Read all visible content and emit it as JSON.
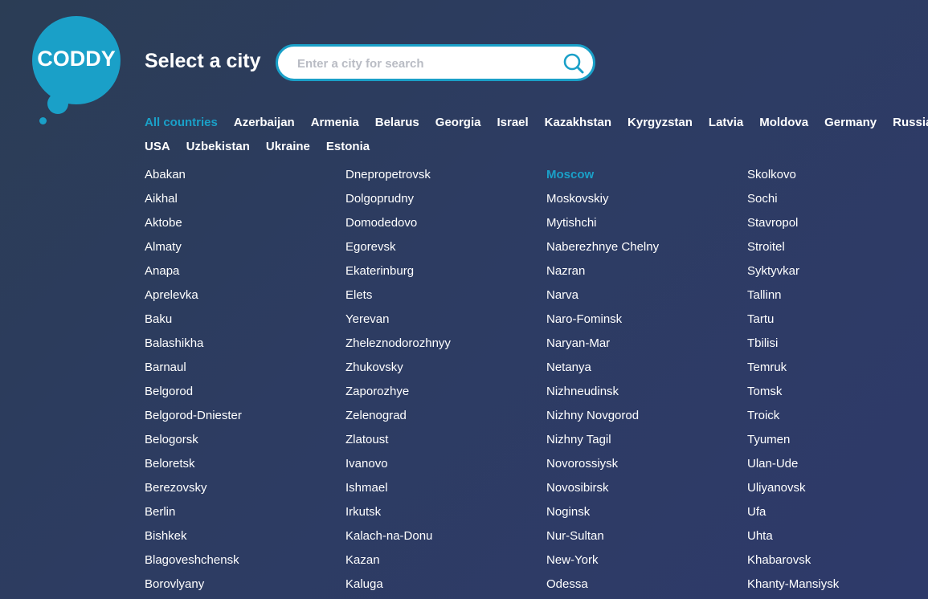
{
  "logo": {
    "text": "CODDY"
  },
  "title": "Select a city",
  "search": {
    "placeholder": "Enter a city for search",
    "value": ""
  },
  "countries_row1": [
    {
      "label": "All countries",
      "active": true
    },
    {
      "label": "Azerbaijan"
    },
    {
      "label": "Armenia"
    },
    {
      "label": "Belarus"
    },
    {
      "label": "Georgia"
    },
    {
      "label": "Israel"
    },
    {
      "label": "Kazakhstan"
    },
    {
      "label": "Kyrgyzstan"
    },
    {
      "label": "Latvia"
    },
    {
      "label": "Moldova"
    },
    {
      "label": "Germany"
    },
    {
      "label": "Russia"
    }
  ],
  "countries_row2": [
    {
      "label": "USA"
    },
    {
      "label": "Uzbekistan"
    },
    {
      "label": "Ukraine"
    },
    {
      "label": "Estonia"
    }
  ],
  "city_columns": [
    [
      "Abakan",
      "Aikhal",
      "Aktobe",
      "Almaty",
      "Anapa",
      "Aprelevka",
      "Baku",
      "Balashikha",
      "Barnaul",
      "Belgorod",
      "Belgorod-Dniester",
      "Belogorsk",
      "Beloretsk",
      "Berezovsky",
      "Berlin",
      "Bishkek",
      "Blagoveshchensk",
      "Borovlyany"
    ],
    [
      "Dnepropetrovsk",
      "Dolgoprudny",
      "Domodedovo",
      "Egorevsk",
      "Ekaterinburg",
      "Elets",
      "Yerevan",
      "Zheleznodorozhnyy",
      "Zhukovsky",
      "Zaporozhye",
      "Zelenograd",
      "Zlatoust",
      "Ivanovo",
      "Ishmael",
      "Irkutsk",
      "Kalach-na-Donu",
      "Kazan",
      "Kaluga"
    ],
    [
      "Moscow",
      "Moskovskiy",
      "Mytishchi",
      "Naberezhnye Chelny",
      "Nazran",
      "Narva",
      "Naro-Fominsk",
      "Naryan-Mar",
      "Netanya",
      "Nizhneudinsk",
      "Nizhny Novgorod",
      "Nizhny Tagil",
      "Novorossiysk",
      "Novosibirsk",
      "Noginsk",
      "Nur-Sultan",
      "New-York",
      "Odessa"
    ],
    [
      "Skolkovo",
      "Sochi",
      "Stavropol",
      "Stroitel",
      "Syktyvkar",
      "Tallinn",
      "Tartu",
      "Tbilisi",
      "Temruk",
      "Tomsk",
      "Troick",
      "Tyumen",
      "Ulan-Ude",
      "Uliyanovsk",
      "Ufa",
      "Uhta",
      "Khabarovsk",
      "Khanty-Mansiysk"
    ]
  ],
  "active_city": "Moscow",
  "colors": {
    "accent": "#1aa0c8",
    "background": "#2d3c5e",
    "text": "#ffffff"
  }
}
